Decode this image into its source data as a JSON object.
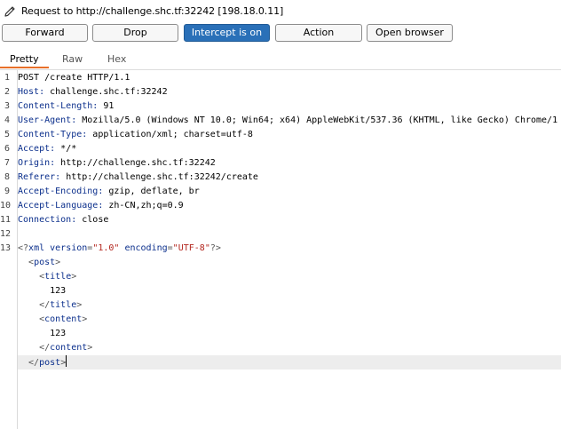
{
  "header": {
    "request_title": "Request to http://challenge.shc.tf:32242",
    "ip": "[198.18.0.11]"
  },
  "toolbar": {
    "forward": "Forward",
    "drop": "Drop",
    "intercept": "Intercept is on",
    "action": "Action",
    "open_browser": "Open browser"
  },
  "tabs": {
    "pretty": "Pretty",
    "raw": "Raw",
    "hex": "Hex",
    "active": "Pretty"
  },
  "editor": {
    "line_numbers": [
      "1",
      "2",
      "3",
      "4",
      "5",
      "6",
      "7",
      "8",
      "9",
      "10",
      "11",
      "12",
      "13"
    ],
    "request_line": "POST /create HTTP/1.1",
    "headers": [
      {
        "name": "Host",
        "value": "challenge.shc.tf:32242"
      },
      {
        "name": "Content-Length",
        "value": "91"
      },
      {
        "name": "User-Agent",
        "value": "Mozilla/5.0 (Windows NT 10.0; Win64; x64) AppleWebKit/537.36 (KHTML, like Gecko) Chrome/1"
      },
      {
        "name": "Content-Type",
        "value": "application/xml; charset=utf-8"
      },
      {
        "name": "Accept",
        "value": "*/*"
      },
      {
        "name": "Origin",
        "value": "http://challenge.shc.tf:32242"
      },
      {
        "name": "Referer",
        "value": "http://challenge.shc.tf:32242/create"
      },
      {
        "name": "Accept-Encoding",
        "value": "gzip, deflate, br"
      },
      {
        "name": "Accept-Language",
        "value": "zh-CN,zh;q=0.9"
      },
      {
        "name": "Connection",
        "value": "close"
      }
    ],
    "xml_decl": {
      "version": "1.0",
      "encoding": "UTF-8"
    },
    "body": {
      "root_tag": "post",
      "fields": [
        {
          "tag": "title",
          "value": "123"
        },
        {
          "tag": "content",
          "value": "123"
        }
      ]
    }
  },
  "colors": {
    "intercept_on": "#2a70b8",
    "active_tab_underline": "#e8702a",
    "header_name": "#0b2f8c",
    "xml_string": "#b3261e"
  }
}
